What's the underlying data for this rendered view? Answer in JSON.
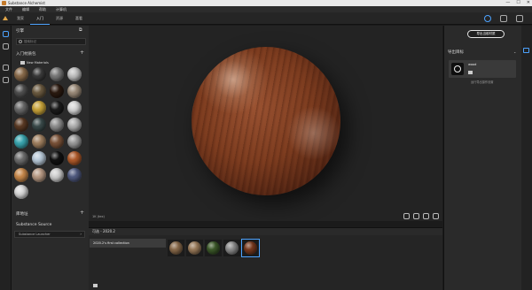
{
  "window": {
    "title": "Substance Alchemist",
    "controls": [
      "—",
      "☐",
      "✕"
    ]
  },
  "menu": [
    "文件",
    "编辑",
    "帮助",
    "计算机"
  ],
  "tabs": [
    {
      "label": "我家",
      "active": false
    },
    {
      "label": "入门",
      "active": true
    },
    {
      "label": "资源",
      "active": false
    },
    {
      "label": "喜看",
      "active": false
    }
  ],
  "left_panel": {
    "title": "引擎",
    "search": {
      "placeholder": "搜索标记"
    },
    "section_title": "入门材质包",
    "folder_label": "New Materials",
    "materials": [
      {
        "color": "#8a6b4b"
      },
      {
        "color": "#3a3a3a"
      },
      {
        "color": "#7a7a7a"
      },
      {
        "color": "#c0c0c0"
      },
      {
        "color": "#4f4f4f"
      },
      {
        "color": "#6b5a40"
      },
      {
        "color": "#2b1a10"
      },
      {
        "color": "#9a8a78"
      },
      {
        "color": "#6a6a6a"
      },
      {
        "color": "#c9a43a"
      },
      {
        "color": "#1b1b1b"
      },
      {
        "color": "#d6d6d6"
      },
      {
        "color": "#5a3a24"
      },
      {
        "color": "#3a4a4a"
      },
      {
        "color": "#8e8e8e"
      },
      {
        "color": "#b0b0b0"
      },
      {
        "color": "#3aa6b0"
      },
      {
        "color": "#a08060"
      },
      {
        "color": "#7a5238"
      },
      {
        "color": "#9a9a9a"
      },
      {
        "color": "#6e6e6e"
      },
      {
        "color": "#b9cad9"
      },
      {
        "color": "#111111"
      },
      {
        "color": "#b05a2a"
      },
      {
        "color": "#c8884a"
      },
      {
        "color": "#b89a84"
      },
      {
        "color": "#cfcfcf"
      },
      {
        "color": "#505a80"
      },
      {
        "color": "#d8d8d8"
      }
    ],
    "history_title": "库地址",
    "source": {
      "title": "Substance Source",
      "dropdown": "Substance Launcher"
    }
  },
  "viewport": {
    "resolution": "1K (tex)",
    "material": {
      "name": "wood",
      "base_color": "#7a3a1e"
    }
  },
  "bottom_panel": {
    "header": "可选 - 2020.2",
    "collection": "2020.2's first collection",
    "swatches": [
      {
        "color": "#8a6b4b",
        "selected": false
      },
      {
        "color": "#9a7b5a",
        "selected": false
      },
      {
        "color": "#3d5a2a",
        "selected": false
      },
      {
        "color": "#8d8d8d",
        "selected": false
      },
      {
        "color": "#7a3a1e",
        "selected": true
      }
    ]
  },
  "right_panel": {
    "export_button": "导出当前材质",
    "header": "导出目标",
    "card": {
      "name": "wood"
    },
    "link": "运行导出操作设置"
  }
}
